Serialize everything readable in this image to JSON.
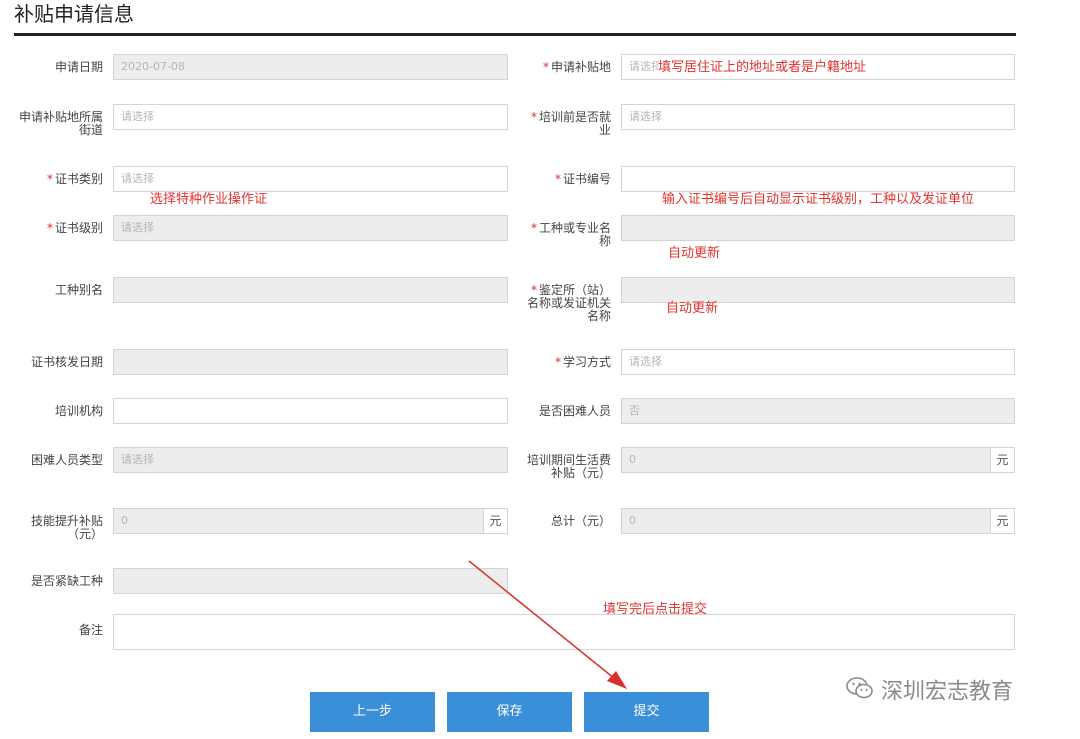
{
  "page": {
    "title": "补贴申请信息"
  },
  "fields": {
    "apply_date": {
      "label": "申请日期",
      "value": "2020-07-08"
    },
    "apply_place": {
      "label": "申请补贴地",
      "placeholder": "请选择"
    },
    "street": {
      "label_line1": "申请补贴地所属",
      "label_line2": "街道",
      "placeholder": "请选择"
    },
    "employed_before": {
      "label_line1": "培训前是否就",
      "label_line2": "业",
      "placeholder": "请选择"
    },
    "cert_type": {
      "label": "证书类别",
      "placeholder": "请选择"
    },
    "cert_number": {
      "label": "证书编号",
      "value": ""
    },
    "cert_level": {
      "label": "证书级别",
      "placeholder": "请选择"
    },
    "profession": {
      "label_line1": "工种或专业名",
      "label_line2": "称",
      "value": ""
    },
    "job_alias": {
      "label": "工种别名",
      "value": ""
    },
    "authority": {
      "label_line1": "鉴定所（站）",
      "label_line2": "名称或发证机关",
      "label_line3": "名称",
      "value": ""
    },
    "issue_date": {
      "label": "证书核发日期",
      "value": ""
    },
    "study_mode": {
      "label": "学习方式",
      "placeholder": "请选择"
    },
    "institution": {
      "label": "培训机构",
      "value": ""
    },
    "hardship": {
      "label": "是否困难人员",
      "value": "否"
    },
    "hardship_type": {
      "label": "困难人员类型",
      "placeholder": "请选择"
    },
    "living_subsidy": {
      "label_line1": "培训期间生活费",
      "label_line2": "补贴（元）",
      "value": "0",
      "unit": "元"
    },
    "skill_subsidy": {
      "label_line1": "技能提升补贴",
      "label_line2": "（元）",
      "value": "0",
      "unit": "元"
    },
    "total": {
      "label": "总计（元）",
      "value": "0",
      "unit": "元"
    },
    "shortage": {
      "label": "是否紧缺工种",
      "value": ""
    },
    "remark": {
      "label": "备注",
      "value": ""
    }
  },
  "annotations": {
    "address_note": "填写居住证上的地址或者是户籍地址",
    "cert_type_note": "选择特种作业操作证",
    "cert_number_note": "输入证书编号后自动显示证书级别，工种以及发证单位",
    "auto1": "自动更新",
    "auto2": "自动更新",
    "submit_note": "填写完后点击提交"
  },
  "buttons": {
    "prev": "上一步",
    "save": "保存",
    "submit": "提交"
  },
  "watermark": {
    "text": "深圳宏志教育",
    "icon": "wechat-icon"
  },
  "colors": {
    "primary": "#3a8fd9",
    "required": "#d9302b",
    "note": "#e0332e"
  }
}
